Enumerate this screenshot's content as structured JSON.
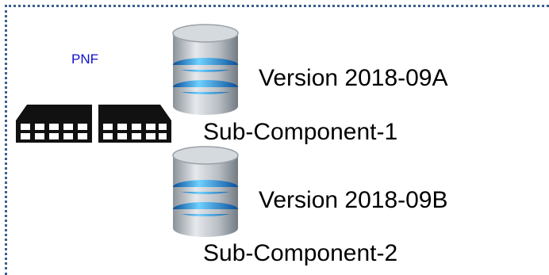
{
  "pnf": {
    "label": "PNF"
  },
  "components": [
    {
      "version": "Version 2018-09A",
      "name": "Sub-Component-1"
    },
    {
      "version": "Version 2018-09B",
      "name": "Sub-Component-2"
    }
  ],
  "colors": {
    "frame": "#3a5f8f",
    "pnf_label": "#1010d0",
    "device": "#111111",
    "db_silver": "#c9ced3",
    "db_blue": "#2a8fe0"
  },
  "icons": {
    "device": "network-device-icon",
    "database": "database-icon"
  }
}
